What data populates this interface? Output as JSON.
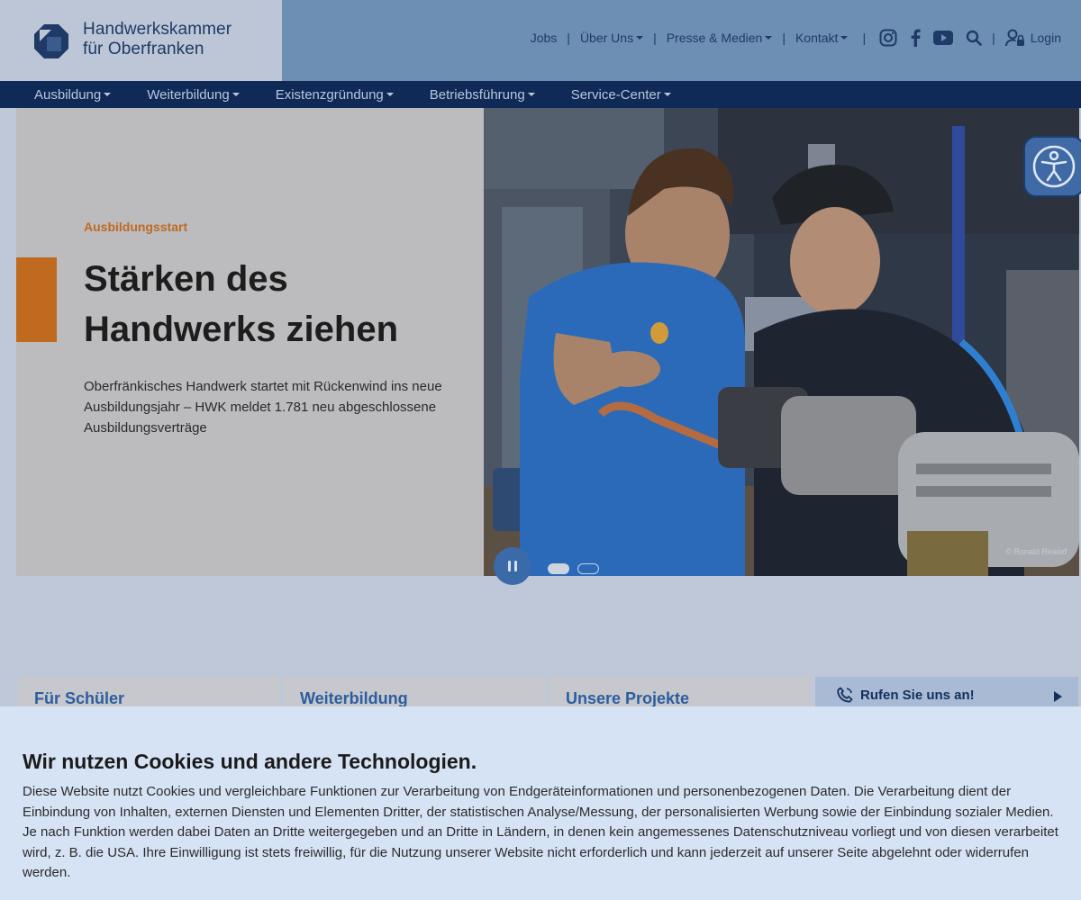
{
  "header": {
    "logo_line1": "Handwerkskammer",
    "logo_line2": "für Oberfranken",
    "top_links": [
      {
        "label": "Jobs",
        "dropdown": false
      },
      {
        "label": "Über Uns",
        "dropdown": true
      },
      {
        "label": "Presse & Medien",
        "dropdown": true
      },
      {
        "label": "Kontakt",
        "dropdown": true
      }
    ],
    "social_icons": [
      "instagram-icon",
      "facebook-icon",
      "youtube-icon",
      "search-icon"
    ],
    "login_label": "Login"
  },
  "main_nav": [
    "Ausbildung",
    "Weiterbildung",
    "Existenzgründung",
    "Betriebsführung",
    "Service-Center"
  ],
  "hero": {
    "kicker": "Ausbildungsstart",
    "title_line1": "Stärken des",
    "title_line2": "Handwerks ziehen",
    "text": "Oberfränkisches Handwerk startet mit Rückenwind ins neue Ausbildungsjahr – HWK meldet 1.781 neu abgeschlossene Ausbildungsverträge",
    "photo_credit": "© Ronald Rinklef",
    "slides_total": 2,
    "slide_active": 1
  },
  "cards": [
    "Für Schüler",
    "Weiterbildung",
    "Unsere Projekte"
  ],
  "call_card": "Rufen Sie uns an!",
  "cookie": {
    "title": "Wir nutzen Cookies und andere Technologien.",
    "text": "Diese Website nutzt Cookies und vergleichbare Funktionen zur Verarbeitung von Endgeräteinformationen und personenbezogenen Daten. Die Verarbeitung dient der Einbindung von Inhalten, externen Diensten und Elementen Dritter, der statistischen Analyse/Messung, der personalisierten Werbung sowie der Einbindung sozialer Medien. Je nach Funktion werden dabei Daten an Dritte weitergegeben und an Dritte in Ländern, in denen kein angemessenes Datenschutzniveau vorliegt und von diesen verarbeitet wird, z. B. die USA. Ihre Einwilligung ist stets freiwillig, für die Nutzung unserer Website nicht erforderlich und kann jederzeit auf unserer Seite abgelehnt oder widerrufen werden."
  },
  "colors": {
    "header_bg": "#6e8fb4",
    "nav_bg": "#0f2a57",
    "accent_orange": "#c06a1f",
    "link_blue": "#2d5d9e",
    "cookie_bg": "#d6e3f5"
  }
}
